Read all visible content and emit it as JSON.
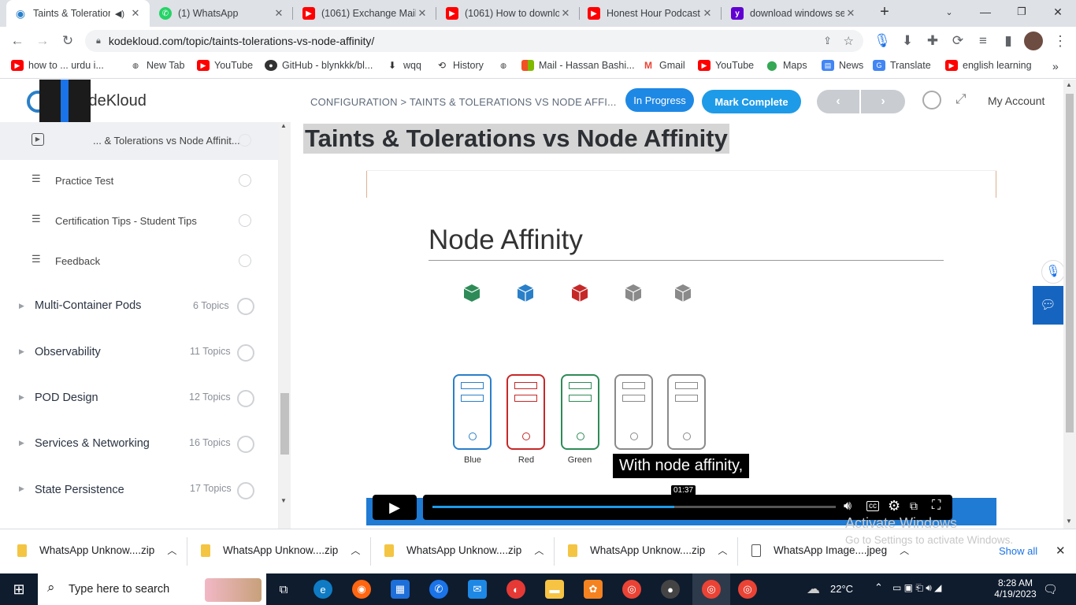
{
  "browser": {
    "tabs": [
      {
        "title": "Taints & Toleration",
        "active": true,
        "icon": "kodekloud-favicon"
      },
      {
        "title": "(1) WhatsApp",
        "icon": "whatsapp-favicon"
      },
      {
        "title": "(1061) Exchange Mail",
        "icon": "youtube-favicon"
      },
      {
        "title": "(1061) How to downlo",
        "icon": "youtube-favicon"
      },
      {
        "title": "Honest Hour Podcast",
        "icon": "youtube-favicon"
      },
      {
        "title": "download windows se",
        "icon": "yahoo-favicon"
      }
    ],
    "url": "kodekloud.com/topic/taints-tolerations-vs-node-affinity/",
    "bookmarks": [
      {
        "label": "how to ... urdu i...",
        "icon": "youtube-icon"
      },
      {
        "label": "New Tab",
        "icon": "globe-icon"
      },
      {
        "label": "YouTube",
        "icon": "youtube-icon"
      },
      {
        "label": "GitHub - blynkkk/bl...",
        "icon": "github-icon"
      },
      {
        "label": "wqq",
        "icon": "download-icon"
      },
      {
        "label": "History",
        "icon": "history-icon"
      },
      {
        "label": "",
        "icon": "globe-icon"
      },
      {
        "label": "Mail - Hassan Bashi...",
        "icon": "microsoft-icon"
      },
      {
        "label": "Gmail",
        "icon": "gmail-icon"
      },
      {
        "label": "YouTube",
        "icon": "youtube-icon"
      },
      {
        "label": "Maps",
        "icon": "maps-icon"
      },
      {
        "label": "News",
        "icon": "news-icon"
      },
      {
        "label": "Translate",
        "icon": "translate-icon"
      },
      {
        "label": "english learning",
        "icon": "youtube-icon"
      }
    ]
  },
  "site": {
    "logo_text": "KodeKloud",
    "breadcrumb": "CONFIGURATION > TAINTS & TOLERATIONS VS NODE AFFI...",
    "status_button": "In Progress",
    "complete_button": "Mark Complete",
    "account": "My Account",
    "page_title": "Taints & Tolerations vs Node Affinity"
  },
  "sidebar": {
    "current_lesson": "... & Tolerations vs Node Affinit...",
    "lessons": [
      {
        "label": "Practice Test"
      },
      {
        "label": "Certification Tips - Student Tips"
      },
      {
        "label": "Feedback"
      }
    ],
    "modules": [
      {
        "label": "Multi-Container Pods",
        "count": "6 Topics"
      },
      {
        "label": "Observability",
        "count": "11 Topics"
      },
      {
        "label": "POD Design",
        "count": "12 Topics"
      },
      {
        "label": "Services & Networking",
        "count": "16 Topics"
      },
      {
        "label": "State Persistence",
        "count": "17 Topics"
      }
    ]
  },
  "video": {
    "slide_title": "Node Affinity",
    "pods": [
      {
        "color": "#2e8b57"
      },
      {
        "color": "#2a7fc9"
      },
      {
        "color": "#c62828"
      },
      {
        "color": "#8a8a8a"
      },
      {
        "color": "#8a8a8a"
      }
    ],
    "nodes": [
      {
        "label": "Blue",
        "color": "#2a7fc9"
      },
      {
        "label": "Red",
        "color": "#c62828"
      },
      {
        "label": "Green",
        "color": "#2e8b57"
      },
      {
        "label": "",
        "color": "#8a8a8a"
      },
      {
        "label": "",
        "color": "#8a8a8a"
      }
    ],
    "caption": "With node affinity,",
    "time": "01:37",
    "progress": 0.6
  },
  "watermark": {
    "line1": "Activate Windows",
    "line2": "Go to Settings to activate Windows."
  },
  "downloads": {
    "items": [
      {
        "name": "WhatsApp Unknow....zip"
      },
      {
        "name": "WhatsApp Unknow....zip"
      },
      {
        "name": "WhatsApp Unknow....zip"
      },
      {
        "name": "WhatsApp Unknow....zip"
      },
      {
        "name": "WhatsApp Image....jpeg"
      }
    ],
    "show_all": "Show all"
  },
  "taskbar": {
    "search_placeholder": "Type here to search",
    "weather": "22°C",
    "time": "8:28 AM",
    "date": "4/19/2023"
  }
}
